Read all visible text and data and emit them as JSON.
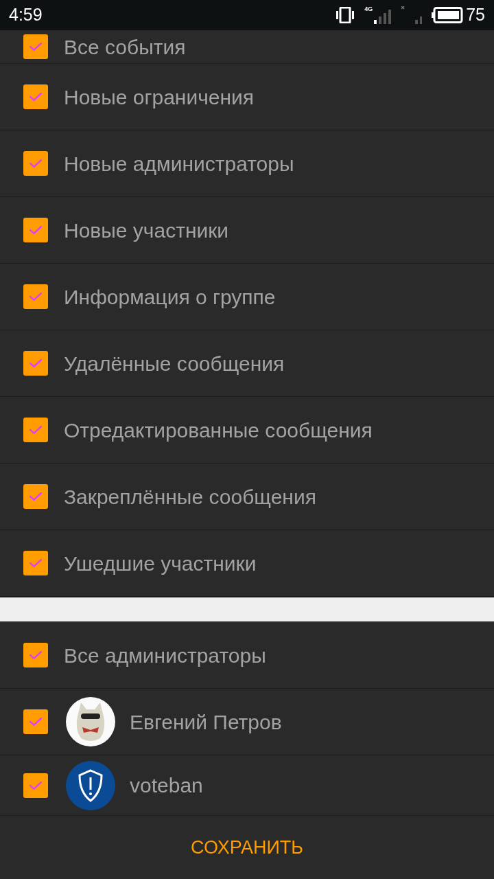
{
  "status_bar": {
    "time": "4:59",
    "network": "4G",
    "battery": "75"
  },
  "event_filters": [
    {
      "label": "Все события",
      "checked": true
    },
    {
      "label": "Новые ограничения",
      "checked": true
    },
    {
      "label": "Новые администраторы",
      "checked": true
    },
    {
      "label": "Новые участники",
      "checked": true
    },
    {
      "label": "Информация о группе",
      "checked": true
    },
    {
      "label": "Удалённые сообщения",
      "checked": true
    },
    {
      "label": "Отредактированные сообщения",
      "checked": true
    },
    {
      "label": "Закреплённые сообщения",
      "checked": true
    },
    {
      "label": "Ушедшие участники",
      "checked": true
    }
  ],
  "admin_filters": [
    {
      "kind": "all",
      "label": "Все администраторы",
      "checked": true
    },
    {
      "kind": "user",
      "label": "Евгений Петров",
      "checked": true
    },
    {
      "kind": "bot",
      "label": "voteban",
      "checked": true
    }
  ],
  "save_button": "СОХРАНИТЬ"
}
